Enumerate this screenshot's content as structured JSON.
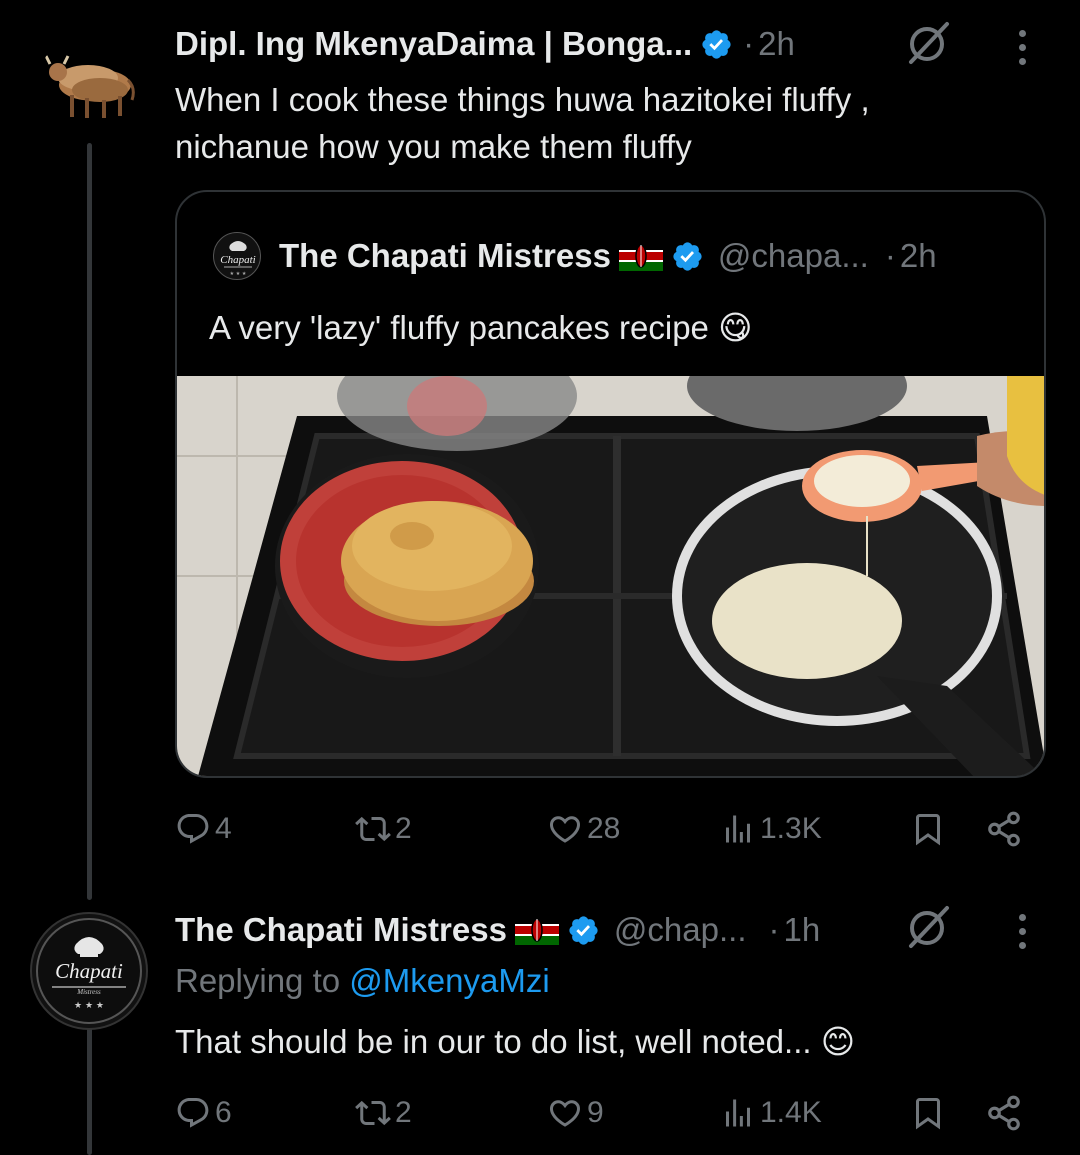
{
  "tweet1": {
    "name": "Dipl. Ing MkenyaDaima | Bonga...",
    "separator": "·",
    "time": "2h",
    "text_line1": "When I cook these things huwa hazitokei fluffy ,",
    "text_line2": "nichanue how you make them fluffy",
    "avatar_icon": "cattle-herd-avatar",
    "quote": {
      "name": "The Chapati Mistress",
      "flag": "kenya-flag",
      "handle": "@chapa...",
      "separator": "·",
      "time": "2h",
      "text": "A very 'lazy' fluffy pancakes recipe",
      "emoji": "😋",
      "image": "pancakes-on-stove-photo"
    },
    "actions": {
      "replies": "4",
      "reposts": "2",
      "likes": "28",
      "views": "1.3K"
    }
  },
  "tweet2": {
    "name": "The Chapati Mistress",
    "flag": "kenya-flag",
    "handle": "@chap...",
    "separator": "·",
    "time": "1h",
    "avatar_title": "Chapati",
    "avatar_sub": "Mistress",
    "replying_prefix": "Replying to",
    "replying_handle": "@MkenyaMzi",
    "text": "That should be in our to do list, well noted...",
    "emoji": "😊",
    "actions": {
      "replies": "6",
      "reposts": "2",
      "likes": "9",
      "views": "1.4K"
    }
  },
  "colors": {
    "background": "#000000",
    "text": "#e7e9ea",
    "muted": "#71767b",
    "link": "#1d9bf0",
    "verified": "#1d9bf0",
    "border": "#2f3336"
  }
}
